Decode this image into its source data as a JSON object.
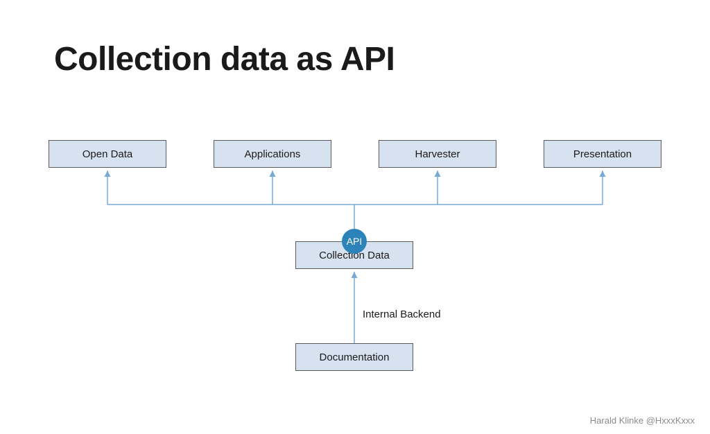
{
  "title": "Collection data as API",
  "top_boxes": [
    {
      "label": "Open Data"
    },
    {
      "label": "Applications"
    },
    {
      "label": "Harvester"
    },
    {
      "label": "Presentation"
    }
  ],
  "middle_box": {
    "label": "Collection Data"
  },
  "bottom_box": {
    "label": "Documentation"
  },
  "api_badge": "API",
  "edge_label": "Internal Backend",
  "footer_author": "Harald Klinke",
  "footer_handle": "@HxxxKxxx",
  "colors": {
    "box_fill": "#d6e2ef",
    "box_border": "#5a5a5a",
    "connector": "#77a9d6",
    "api_fill": "#2b83ba",
    "footer_text": "#8a8a8a"
  }
}
